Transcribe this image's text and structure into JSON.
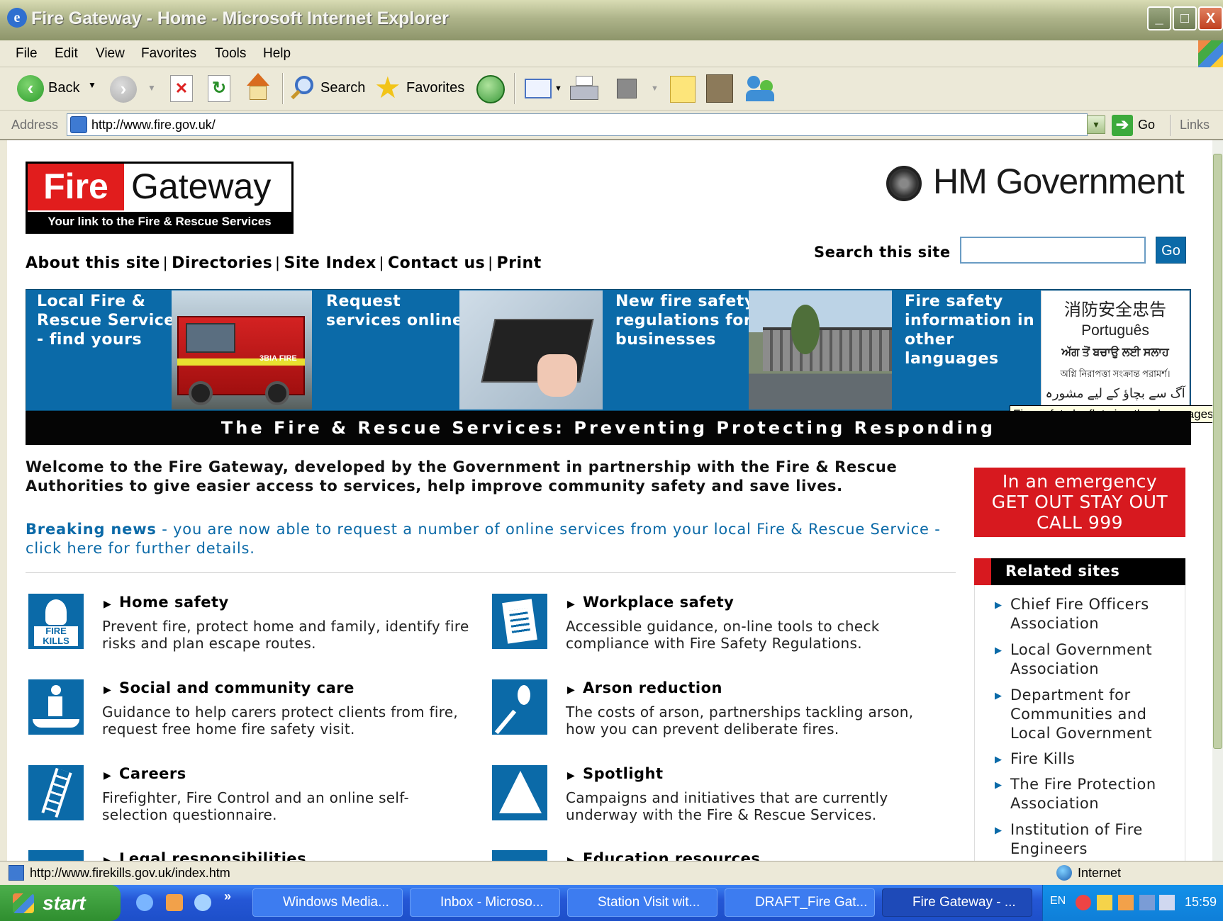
{
  "window": {
    "title": "Fire Gateway - Home - Microsoft Internet Explorer",
    "controls": {
      "minimize": "_",
      "maximize": "□",
      "close": "X"
    }
  },
  "menu": [
    "File",
    "Edit",
    "View",
    "Favorites",
    "Tools",
    "Help"
  ],
  "toolbar": {
    "back": "Back",
    "search": "Search",
    "favorites": "Favorites"
  },
  "address": {
    "label": "Address",
    "url": "http://www.fire.gov.uk/",
    "go": "Go",
    "links": "Links"
  },
  "site": {
    "logo": {
      "fire": "Fire",
      "gateway": "Gateway",
      "tagline": "Your link to the Fire & Rescue Services"
    },
    "hmgov": "HM Government",
    "search": {
      "label": "Search this site",
      "value": "",
      "button": "Go"
    },
    "nav": [
      "About this site",
      "Directories",
      "Site Index",
      "Contact us",
      "Print"
    ],
    "tiles": [
      {
        "text": "Local Fire & Rescue Service - find yours"
      },
      {
        "text": "Request services online"
      },
      {
        "text": "New fire safety regulations for businesses"
      },
      {
        "text": "Fire safety information in other languages"
      }
    ],
    "languages": [
      "消防安全忠告",
      "Português",
      "ਅੱਗ ਤੋਂ ਬਚਾਉ ਲਈ ਸਲਾਹ",
      "অগ্নি নিরাপত্তা সংক্রান্ত পরামর্শ।",
      "آگ سے بچاؤ کے لیے مشورہ"
    ],
    "truck_label": "3BIA FIRE",
    "tooltip": "Fire safety leaflets in other languages",
    "banner": "The Fire & Rescue Services: Preventing Protecting Responding",
    "welcome": "Welcome to the Fire Gateway, developed by the Government in partnership with the Fire & Rescue Authorities to give easier access to services, help improve community safety and save lives.",
    "breaking_label": "Breaking news",
    "breaking_text": " - you are now able to request a number of online services from your local Fire & Rescue Service - click here for further details.",
    "emergency": [
      "In an emergency",
      "GET OUT STAY OUT",
      "CALL 999"
    ],
    "sections_left": [
      {
        "title": "Home safety",
        "desc": "Prevent fire, protect home and family, identify fire risks and plan escape routes.",
        "icon": "fire-kills-icon",
        "icon_text": "FIRE KILLS"
      },
      {
        "title": "Social and community care",
        "desc": "Guidance to help carers protect clients from fire, request free home fire safety visit.",
        "icon": "care-icon"
      },
      {
        "title": "Careers",
        "desc": "Firefighter, Fire Control and an online self-selection questionnaire.",
        "icon": "ladder-icon"
      },
      {
        "title": "Legal responsibilities",
        "desc": "",
        "icon": "legal-icon"
      }
    ],
    "sections_right": [
      {
        "title": "Workplace safety",
        "desc": "Accessible guidance, on-line tools to check compliance with Fire Safety Regulations.",
        "icon": "checklist-icon"
      },
      {
        "title": "Arson reduction",
        "desc": "The costs of arson, partnerships tackling arson, how you can prevent deliberate fires.",
        "icon": "match-flame-icon"
      },
      {
        "title": "Spotlight",
        "desc": "Campaigns and initiatives that are currently underway with the Fire & Rescue Services.",
        "icon": "spotlight-icon"
      },
      {
        "title": "Education resources",
        "desc": "",
        "icon": "education-icon"
      }
    ],
    "related": {
      "title": "Related sites",
      "items": [
        "Chief Fire Officers Association",
        "Local Government Association",
        "Department for Communities and Local Government",
        "Fire Kills",
        "The Fire Protection Association",
        "Institution of Fire Engineers"
      ]
    }
  },
  "status": {
    "url": "http://www.firekills.gov.uk/index.htm",
    "zone": "Internet"
  },
  "taskbar": {
    "start": "start",
    "tasks": [
      "Windows Media...",
      "Inbox - Microso...",
      "Station Visit wit...",
      "DRAFT_Fire Gat...",
      "Fire Gateway - ..."
    ],
    "lang": "EN",
    "clock": "15:59",
    "chevron": "»"
  },
  "colors": {
    "fire_red": "#e11d1d",
    "brand_blue": "#0b6aa8",
    "link_blue": "#0b6aa8",
    "emergency_red": "#d7191f"
  }
}
